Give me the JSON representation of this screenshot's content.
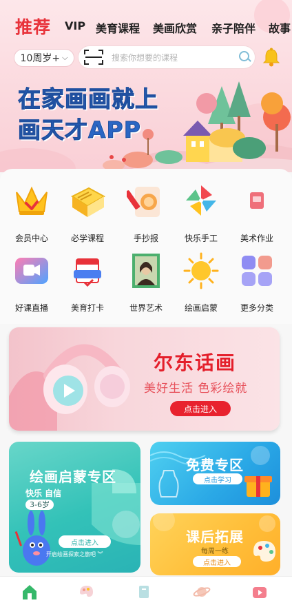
{
  "tabs": [
    "推荐",
    "VIP",
    "美育课程",
    "美画欣赏",
    "亲子陪伴",
    "故事"
  ],
  "age_filter": {
    "label": "10周岁+"
  },
  "search": {
    "placeholder": "搜索你想要的课程"
  },
  "banner": {
    "line1": "在家画画就上",
    "line2": "画天才APP"
  },
  "grid": [
    {
      "label": "会员中心",
      "icon": "crown-icon"
    },
    {
      "label": "必学课程",
      "icon": "book-icon"
    },
    {
      "label": "手抄报",
      "icon": "pencil-lion-icon"
    },
    {
      "label": "快乐手工",
      "icon": "pinwheel-icon"
    },
    {
      "label": "美术作业",
      "icon": "notebook-icon"
    },
    {
      "label": "好课直播",
      "icon": "live-video-icon"
    },
    {
      "label": "美育打卡",
      "icon": "calendar-checkin-icon"
    },
    {
      "label": "世界艺术",
      "icon": "portrait-frame-icon"
    },
    {
      "label": "绘画启蒙",
      "icon": "sun-icon"
    },
    {
      "label": "更多分类",
      "icon": "four-squares-icon"
    }
  ],
  "promo": {
    "title": "尔东话画",
    "subtitle": "美好生活 色彩绘就",
    "button": "点击进入"
  },
  "card_left": {
    "title": "绘画启蒙专区",
    "tag1": "快乐 自信",
    "tag2": "3-6岁",
    "button": "点击进入",
    "footer": "开启绘画探索之旅吧"
  },
  "card_free": {
    "title": "免费专区",
    "button": "点击学习"
  },
  "card_after": {
    "title": "课后拓展",
    "subtitle": "每周一练",
    "button": "点击进入"
  },
  "nav": [
    "home-icon",
    "palette-icon",
    "book-nav-icon",
    "planet-icon",
    "video-nav-icon"
  ],
  "colors": {
    "accent": "#e8323a",
    "banner_text": "#2a66c4",
    "teal": "#33c2b8",
    "blue": "#2aa8e6",
    "yellow": "#ffbf3a"
  }
}
